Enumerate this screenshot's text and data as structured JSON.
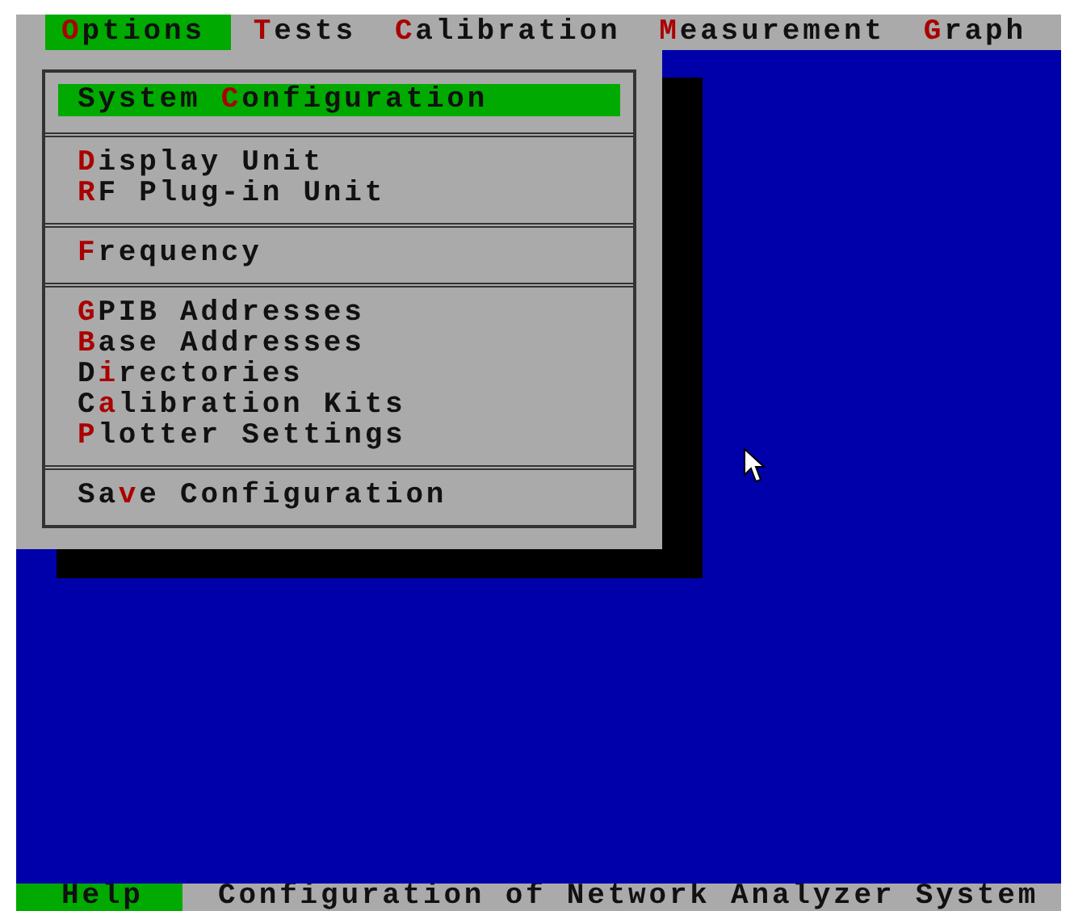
{
  "menu_bar": [
    {
      "key": "O",
      "after": "ptions",
      "selected": true
    },
    {
      "key": "T",
      "after": "ests",
      "selected": false
    },
    {
      "key": "C",
      "after": "alibration",
      "selected": false
    },
    {
      "key": "M",
      "after": "easurement",
      "selected": false
    },
    {
      "key": "G",
      "after": "raph",
      "selected": false
    }
  ],
  "dropdown": {
    "groups": [
      [
        {
          "before": "System ",
          "key": "C",
          "after": "onfiguration",
          "selected": true
        }
      ],
      [
        {
          "key": "D",
          "after": "isplay Unit",
          "selected": false
        },
        {
          "key": "R",
          "after": "F Plug-in Unit",
          "selected": false
        }
      ],
      [
        {
          "key": "F",
          "after": "requency",
          "selected": false
        }
      ],
      [
        {
          "key": "G",
          "after": "PIB Addresses",
          "selected": false
        },
        {
          "key": "B",
          "after": "ase Addresses",
          "selected": false
        },
        {
          "before": "D",
          "key": "i",
          "after": "rectories",
          "selected": false
        },
        {
          "before": "C",
          "key": "a",
          "after": "libration Kits",
          "selected": false
        },
        {
          "key": "P",
          "after": "lotter Settings",
          "selected": false
        }
      ],
      [
        {
          "before": "Sa",
          "key": "v",
          "after": "e Configuration",
          "selected": false
        }
      ]
    ]
  },
  "status_bar": {
    "key_label": "Help",
    "message": "Configuration of Network Analyzer System"
  }
}
